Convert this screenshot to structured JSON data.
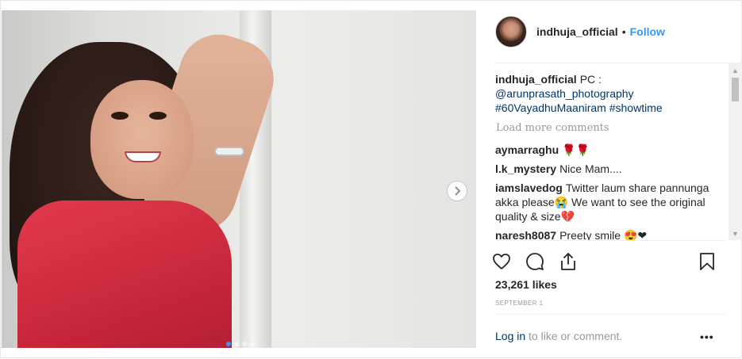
{
  "post": {
    "username": "indhuja_official",
    "separator": "•",
    "follow_label": "Follow"
  },
  "caption": {
    "username": "indhuja_official",
    "line1": "PC :",
    "mention": "@arunprasath_photography",
    "hashtags": "#60VayadhuMaaniram #showtime"
  },
  "load_more": "Load more comments",
  "comments": [
    {
      "user": "aymarraghu",
      "text": "🌹🌹"
    },
    {
      "user": "l.k_mystery",
      "text": "Nice Mam...."
    },
    {
      "user": "iamslavedog",
      "text": "Twitter laum share pannunga akka please😭 We want to see the original quality & size💔"
    },
    {
      "user": "naresh8087",
      "text": "Preety smile 😍❤"
    }
  ],
  "likes": "23,261 likes",
  "date": "SEPTEMBER 1",
  "login": {
    "link_label": "Log in",
    "rest": " to like or comment."
  },
  "more_label": "•••",
  "icons": {
    "like": "heart-icon",
    "comment": "comment-bubble-icon",
    "share": "share-upload-icon",
    "save": "bookmark-icon",
    "next": "chevron-right-icon"
  },
  "carousel": {
    "count": 4,
    "active_index": 0
  },
  "colors": {
    "accent": "#3897f0",
    "link": "#003569",
    "muted": "#999999"
  }
}
